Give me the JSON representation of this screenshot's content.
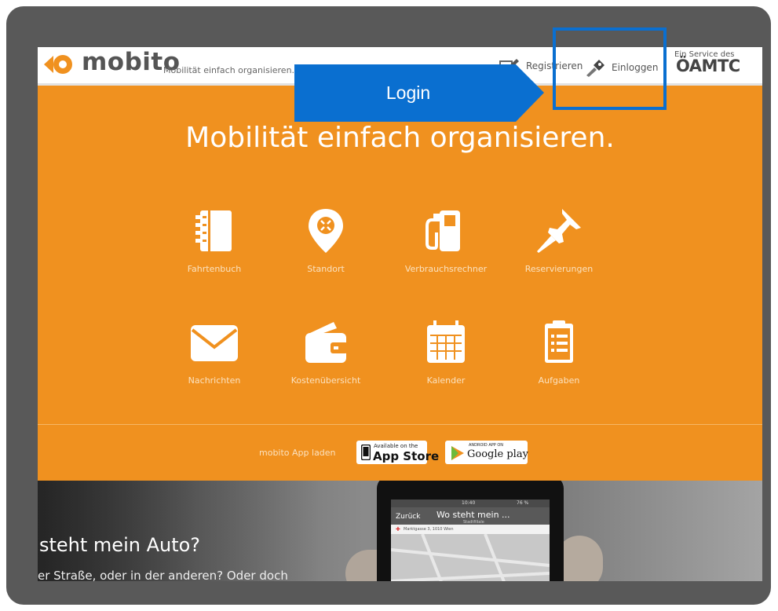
{
  "header": {
    "logo_text": "mobito",
    "tagline": "Mobilität einfach organisieren.",
    "register_label": "Registrieren",
    "login_label": "Einloggen",
    "service_label": "Ein Service des",
    "service_brand": "ÖAMTC"
  },
  "hero": {
    "title": "Mobilität einfach organisieren.",
    "tiles": [
      {
        "label": "Fahrtenbuch",
        "icon": "notebook-icon"
      },
      {
        "label": "Standort",
        "icon": "location-pin-icon"
      },
      {
        "label": "Verbrauchsrechner",
        "icon": "fuel-pump-icon"
      },
      {
        "label": "Reservierungen",
        "icon": "pushpin-icon"
      },
      {
        "label": "Nachrichten",
        "icon": "envelope-icon"
      },
      {
        "label": "Kostenübersicht",
        "icon": "wallet-icon"
      },
      {
        "label": "Kalender",
        "icon": "calendar-icon"
      },
      {
        "label": "Aufgaben",
        "icon": "clipboard-icon"
      }
    ]
  },
  "appbar": {
    "label": "mobito App laden",
    "appstore_small": "Available on the",
    "appstore_big": "App Store",
    "googleplay_small": "ANDROID APP ON",
    "googleplay_big": "Google play"
  },
  "phone": {
    "status_time": "10:40",
    "status_battery": "76 %",
    "back": "Zurück",
    "title": "Wo steht mein ...",
    "subtitle": "Stadtfiliale",
    "address": "Marktgasse 3, 1010 Wien"
  },
  "promo": {
    "heading": "steht mein Auto?",
    "text": "er Straße, oder in der anderen? Oder doch"
  },
  "annotation": {
    "callout_label": "Login"
  },
  "colors": {
    "orange": "#f0911f",
    "frame": "#595959",
    "annotation_blue": "#0a6fd0"
  }
}
